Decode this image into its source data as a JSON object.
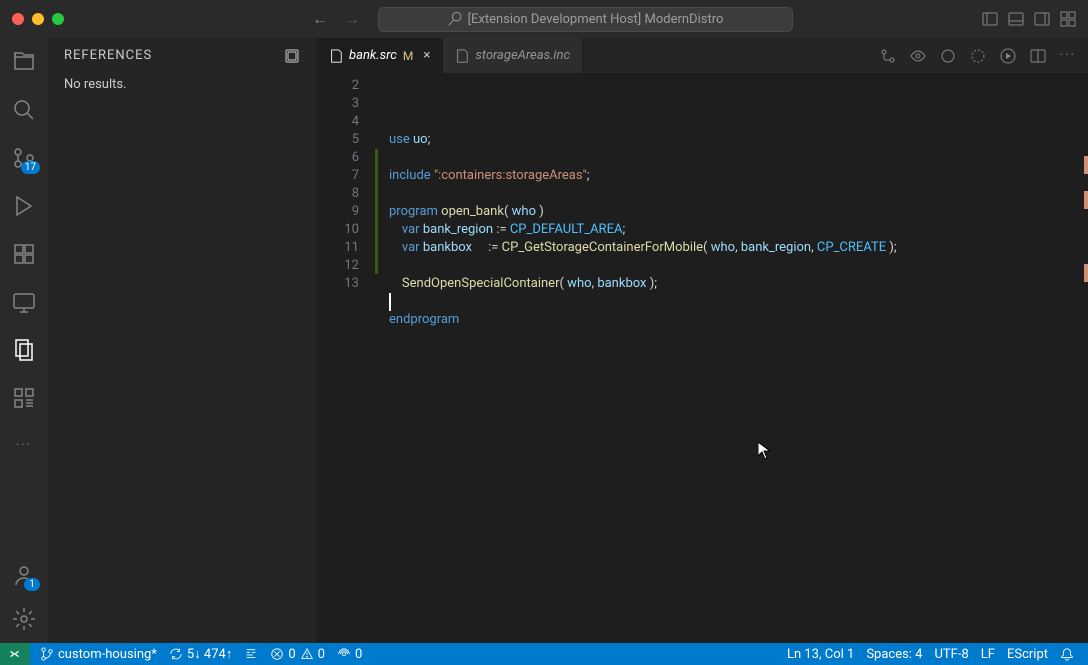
{
  "title": "[Extension Development Host] ModernDistro",
  "panel": {
    "title": "REFERENCES",
    "content": "No results."
  },
  "tabs": [
    {
      "name": "bank.src",
      "modified": "M",
      "active": true
    },
    {
      "name": "storageAreas.inc",
      "modified": "",
      "active": false
    }
  ],
  "activity": {
    "scm_badge": "17",
    "account_badge": "1"
  },
  "code": {
    "lines": [
      {
        "n": "2",
        "html": "<span class='kw'>use</span> <span class='var'>uo</span><span class='punc'>;</span>"
      },
      {
        "n": "3",
        "html": ""
      },
      {
        "n": "4",
        "html": "<span class='kw'>include</span> <span class='str'>\":containers:storageAreas\"</span><span class='punc'>;</span>"
      },
      {
        "n": "5",
        "html": ""
      },
      {
        "n": "6",
        "html": "<span class='kw'>program</span> <span class='fn'>open_bank</span><span class='punc'>(</span> <span class='var'>who</span> <span class='punc'>)</span>"
      },
      {
        "n": "7",
        "html": "    <span class='kw'>var</span> <span class='var'>bank_region</span> <span class='op'>:=</span> <span class='const'>CP_DEFAULT_AREA</span><span class='punc'>;</span>"
      },
      {
        "n": "8",
        "html": "    <span class='kw'>var</span> <span class='var'>bankbox</span>     <span class='op'>:=</span> <span class='fn'>CP_GetStorageContainerForMobile</span><span class='punc'>(</span> <span class='var'>who</span><span class='punc'>,</span> <span class='var'>bank_region</span><span class='punc'>,</span> <span class='const'>CP_CREATE</span> <span class='punc'>);</span>"
      },
      {
        "n": "9",
        "html": ""
      },
      {
        "n": "10",
        "html": "    <span class='fn'>SendOpenSpecialContainer</span><span class='punc'>(</span> <span class='var'>who</span><span class='punc'>,</span> <span class='var'>bankbox</span> <span class='punc'>);</span>"
      },
      {
        "n": "11",
        "html": ""
      },
      {
        "n": "12",
        "html": "<span class='kw'>endprogram</span>"
      },
      {
        "n": "13",
        "html": ""
      }
    ]
  },
  "status": {
    "branch": "custom-housing*",
    "sync": "5↓ 474↑",
    "errors": "0",
    "warnings": "0",
    "ports": "0",
    "position": "Ln 13, Col 1",
    "spaces": "Spaces: 4",
    "encoding": "UTF-8",
    "eol": "LF",
    "language": "EScript"
  }
}
